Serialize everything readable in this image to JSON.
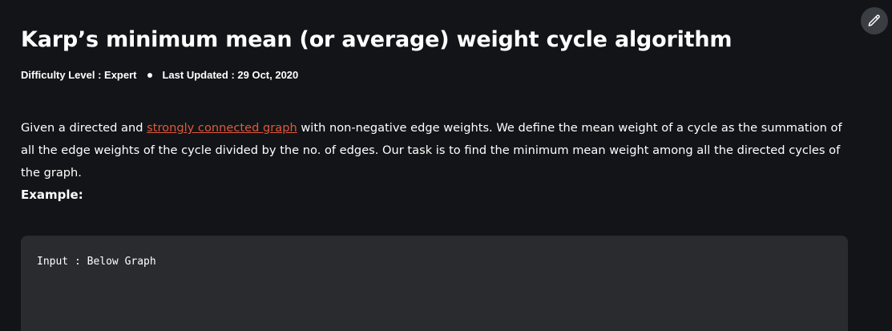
{
  "article": {
    "title": "Karp’s minimum mean (or average) weight cycle algorithm",
    "difficulty": "Difficulty Level : Expert",
    "last_updated": "Last Updated : 29 Oct, 2020",
    "intro_before_link": "Given a directed and ",
    "intro_link": "strongly connected graph",
    "intro_after_link": " with non-negative edge weights. We define the mean weight of a cycle as the summation of all the edge weights of the cycle divided by the no. of edges. Our task is to find the minimum mean weight among all the directed cycles of the graph.",
    "example_label": "Example:",
    "code_line": "Input : Below Graph"
  },
  "toolbar": {
    "edit_icon": "pencil-icon"
  },
  "colors": {
    "background": "#131417",
    "link": "#e0583d",
    "code_background": "#2a2b2f"
  }
}
